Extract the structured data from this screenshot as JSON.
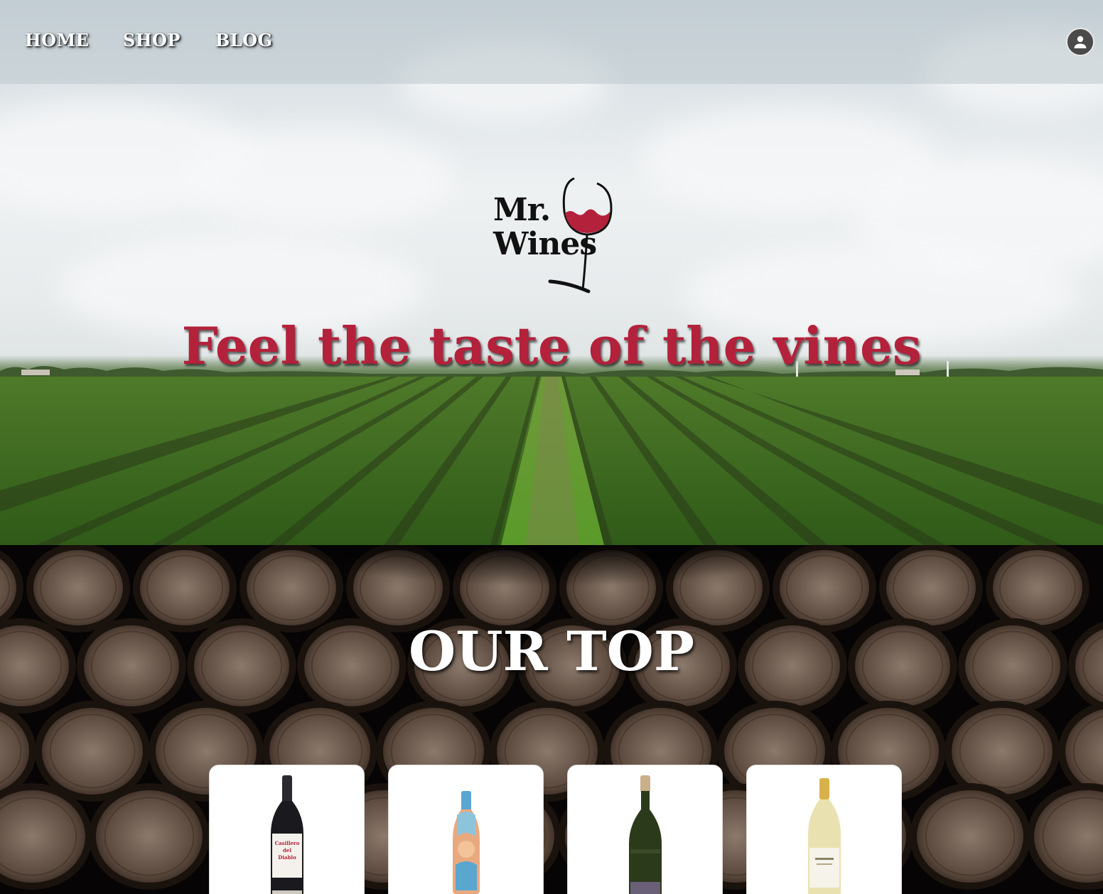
{
  "nav": {
    "home_label": "HOME",
    "shop_label": "SHOP",
    "blog_label": "BLOG",
    "account_icon": "account-circle-icon"
  },
  "hero": {
    "logo_line1": "Mr.",
    "logo_line2": "Wines",
    "tagline": "Feel the taste of the vines"
  },
  "top_section": {
    "title": "OUR TOP",
    "products": [
      {
        "label_text": "Casillero del Diablo",
        "bottle_color": "#1a1a1e",
        "label_color": "#f4f1ec"
      },
      {
        "label_text": "",
        "bottle_color": "#e9a97e",
        "label_color": "#8cc4dc"
      },
      {
        "label_text": "",
        "bottle_color": "#2c3a1c",
        "label_color": "#6a6078"
      },
      {
        "label_text": "",
        "bottle_color": "#e9e2b0",
        "label_color": "#f5f3ea"
      }
    ]
  },
  "colors": {
    "brand_red": "#b3213b",
    "nav_text": "#ffffff"
  }
}
